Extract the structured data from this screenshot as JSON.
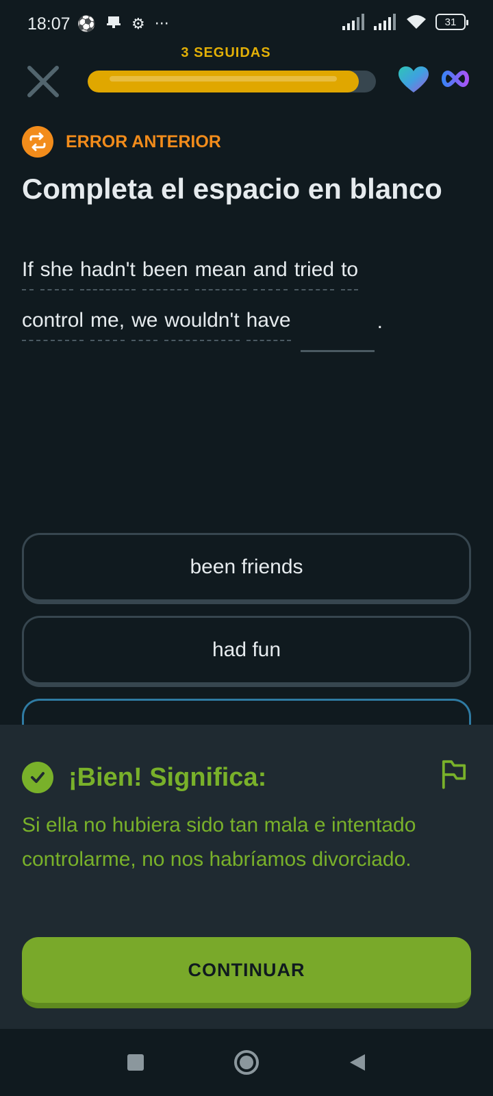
{
  "status_bar": {
    "time": "18:07",
    "more": "···",
    "battery": "31"
  },
  "header": {
    "streak_label": "3 SEGUIDAS",
    "progress_fraction": 0.94
  },
  "badge": {
    "label": "ERROR ANTERIOR"
  },
  "exercise": {
    "title": "Completa el espacio en blanco",
    "line1": [
      "If",
      "she",
      "hadn't",
      "been",
      "mean",
      "and",
      "tried",
      "to"
    ],
    "line2": [
      "control",
      "me,",
      "we",
      "wouldn't",
      "have"
    ],
    "period": "."
  },
  "options": [
    {
      "label": "been friends"
    },
    {
      "label": "had fun"
    }
  ],
  "feedback": {
    "title": "¡Bien! Significa:",
    "text": "Si ella no hubiera sido tan mala e intentado controlarme, no nos habríamos divorciado.",
    "continue_label": "CONTINUAR"
  },
  "colors": {
    "background": "#101a1f",
    "success": "#79b12a",
    "streak": "#e3b007",
    "review": "#f28c1b"
  }
}
